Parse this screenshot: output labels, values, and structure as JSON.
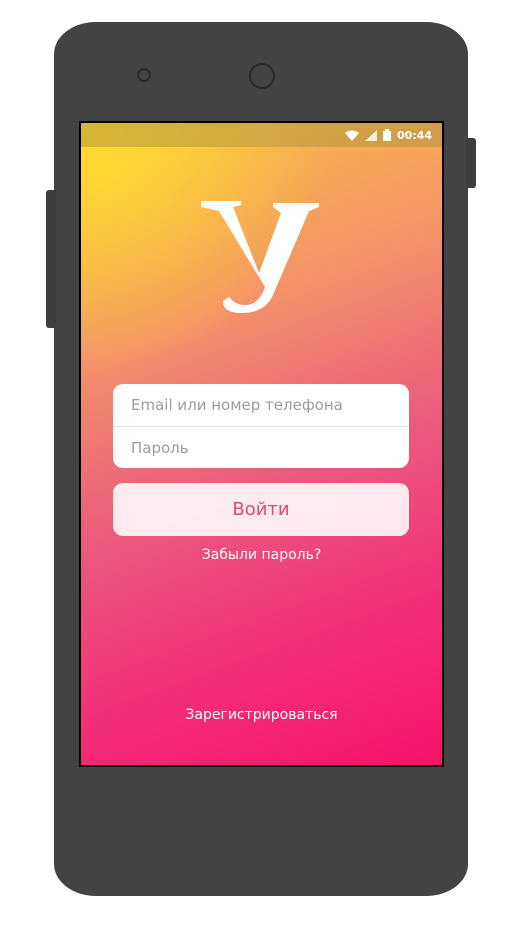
{
  "status_bar": {
    "time": "00:44"
  },
  "login_form": {
    "email_placeholder": "Email или номер телефона",
    "password_placeholder": "Пароль",
    "login_label": "Войти",
    "forgot_label": "Забыли пароль?",
    "register_label": "Зарегистрироваться"
  },
  "colors": {
    "accent": "#e2467a",
    "gradient_top": "#ffde2d",
    "gradient_bottom": "#f7126a"
  }
}
